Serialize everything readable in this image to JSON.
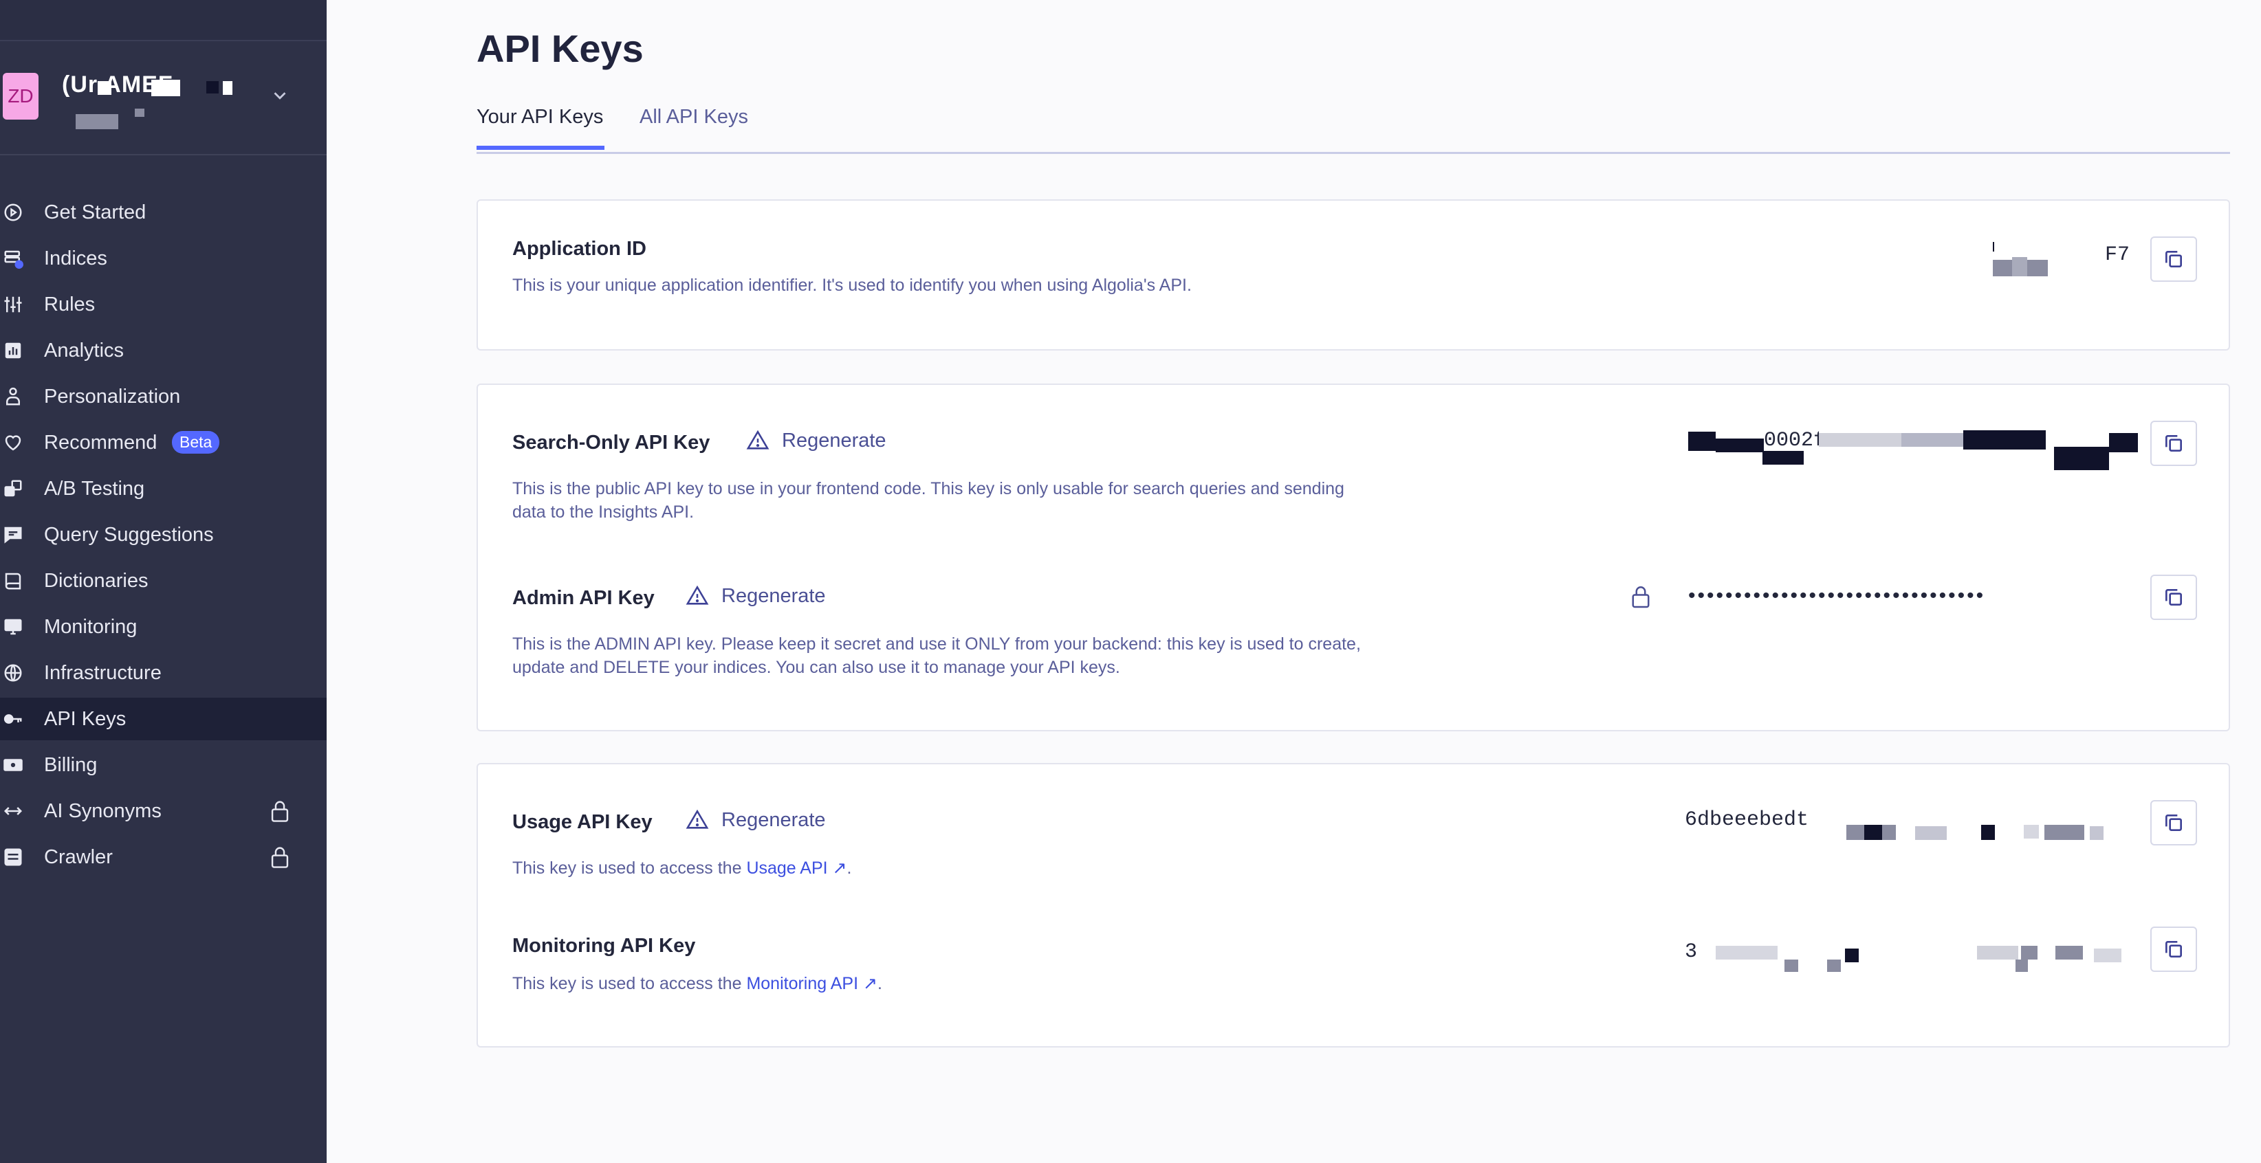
{
  "org": {
    "initials": "ZD",
    "name": "(Ur  AMEF"
  },
  "nav": [
    {
      "label": "Get Started",
      "icon": "play-circle-icon"
    },
    {
      "label": "Indices",
      "icon": "database-icon"
    },
    {
      "label": "Rules",
      "icon": "sliders-icon"
    },
    {
      "label": "Analytics",
      "icon": "bar-chart-icon"
    },
    {
      "label": "Personalization",
      "icon": "person-icon"
    },
    {
      "label": "Recommend",
      "icon": "heart-icon",
      "badge": "Beta"
    },
    {
      "label": "A/B Testing",
      "icon": "ab-test-icon"
    },
    {
      "label": "Query Suggestions",
      "icon": "chat-bubble-icon"
    },
    {
      "label": "Dictionaries",
      "icon": "book-icon"
    },
    {
      "label": "Monitoring",
      "icon": "monitor-icon"
    },
    {
      "label": "Infrastructure",
      "icon": "globe-icon"
    },
    {
      "label": "API Keys",
      "icon": "key-icon",
      "active": true
    },
    {
      "label": "Billing",
      "icon": "billing-icon"
    },
    {
      "label": "AI Synonyms",
      "icon": "arrows-horizontal-icon",
      "locked": true
    },
    {
      "label": "Crawler",
      "icon": "crawler-icon",
      "locked": true
    }
  ],
  "page": {
    "title": "API Keys",
    "tabs": [
      "Your API Keys",
      "All API Keys"
    ]
  },
  "app_id": {
    "title": "Application ID",
    "desc": "This is your unique application identifier. It's used to identify you when using Algolia's API.",
    "value": "F7"
  },
  "search_key": {
    "title": "Search-Only API Key",
    "regenerate": "Regenerate",
    "desc": "This is the public API key to use in your frontend code. This key is only usable for search queries and sending data to the Insights API.",
    "value": "0002f9"
  },
  "admin_key": {
    "title": "Admin API Key",
    "regenerate": "Regenerate",
    "desc": "This is the ADMIN API key. Please keep it secret and use it ONLY from your backend: this key is used to create, update and DELETE your indices. You can also use it to manage your API keys.",
    "value": "••••••••••••••••••••••••••••••••"
  },
  "usage_key": {
    "title": "Usage API Key",
    "regenerate": "Regenerate",
    "desc_prefix": "This key is used to access the ",
    "link": "Usage API",
    "desc_suffix": ".",
    "value": "6dbeeebedt"
  },
  "monitoring_key": {
    "title": "Monitoring API Key",
    "desc_prefix": "This key is used to access the ",
    "link": "Monitoring API",
    "desc_suffix": ".",
    "value": "3"
  }
}
